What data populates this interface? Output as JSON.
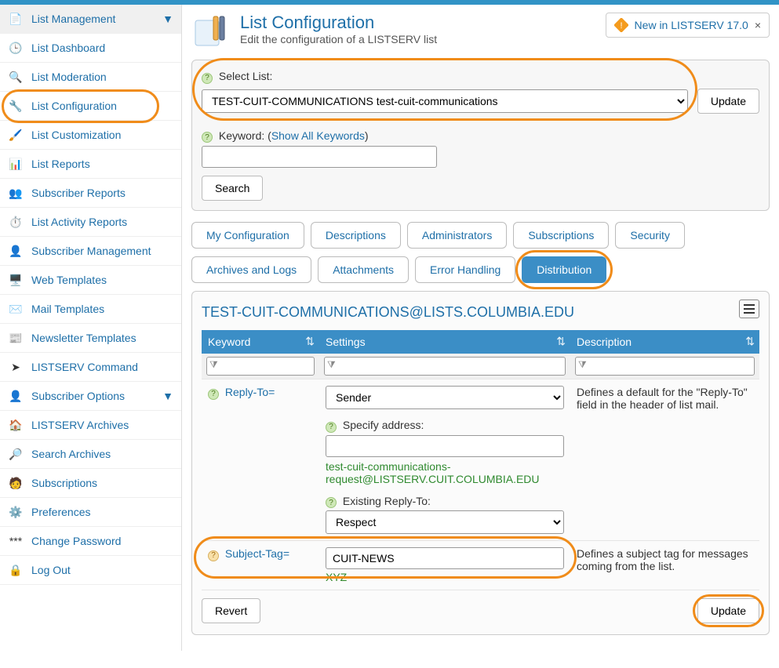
{
  "sidebar": {
    "header": "List Management",
    "items": [
      {
        "label": "List Dashboard",
        "icon": "🕒"
      },
      {
        "label": "List Moderation",
        "icon": "🔍"
      },
      {
        "label": "List Configuration",
        "icon": "🔧",
        "active": true
      },
      {
        "label": "List Customization",
        "icon": "🖌️"
      },
      {
        "label": "List Reports",
        "icon": "📊"
      },
      {
        "label": "Subscriber Reports",
        "icon": "👥"
      },
      {
        "label": "List Activity Reports",
        "icon": "⏱️"
      },
      {
        "label": "Subscriber Management",
        "icon": "👤"
      },
      {
        "label": "Web Templates",
        "icon": "🖥️"
      },
      {
        "label": "Mail Templates",
        "icon": "✉️"
      },
      {
        "label": "Newsletter Templates",
        "icon": "📰"
      },
      {
        "label": "LISTSERV Command",
        "icon": "➤"
      },
      {
        "label": "Subscriber Options",
        "icon": "👤",
        "expandable": true
      },
      {
        "label": "LISTSERV Archives",
        "icon": "🏠"
      },
      {
        "label": "Search Archives",
        "icon": "🔎"
      },
      {
        "label": "Subscriptions",
        "icon": "🧑"
      },
      {
        "label": "Preferences",
        "icon": "⚙️"
      },
      {
        "label": "Change Password",
        "icon": "***"
      },
      {
        "label": "Log Out",
        "icon": "🔒"
      }
    ]
  },
  "header": {
    "title": "List Configuration",
    "subtitle": "Edit the configuration of a LISTSERV list",
    "badge": "New in LISTSERV 17.0"
  },
  "selectPanel": {
    "label": "Select List:",
    "value": "TEST-CUIT-COMMUNICATIONS test-cuit-communications",
    "update": "Update",
    "kwLabel": "Keyword: (",
    "showAll": "Show All Keywords",
    "closeParen": ")",
    "search": "Search"
  },
  "tabs": {
    "row1": [
      "My Configuration",
      "Descriptions",
      "Administrators",
      "Subscriptions",
      "Security"
    ],
    "row2": [
      "Archives and Logs",
      "Attachments",
      "Error Handling",
      "Distribution"
    ]
  },
  "card": {
    "title": "TEST-CUIT-COMMUNICATIONS@LISTS.COLUMBIA.EDU",
    "cols": {
      "k": "Keyword",
      "s": "Settings",
      "d": "Description"
    },
    "rows": [
      {
        "keyword": "Reply-To=",
        "select1": "Sender",
        "specLabel": "Specify address:",
        "specVal": "",
        "green": "test-cuit-communications-request@LISTSERV.CUIT.COLUMBIA.EDU",
        "existLabel": "Existing Reply-To:",
        "select2": "Respect",
        "desc": "Defines a default for the \"Reply-To\" field in the header of list mail."
      },
      {
        "keyword": "Subject-Tag=",
        "value": "CUIT-NEWS",
        "green": "XYZ",
        "desc": "Defines a subject tag for messages coming from the list."
      }
    ],
    "revert": "Revert",
    "updateBtn": "Update"
  }
}
